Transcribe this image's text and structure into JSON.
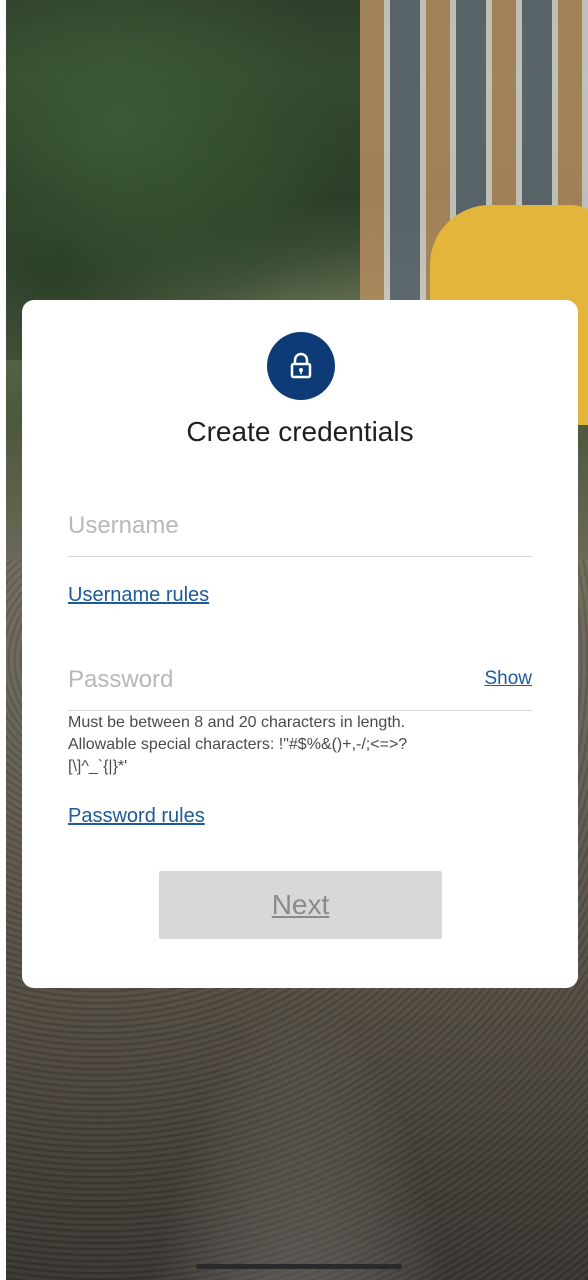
{
  "card": {
    "title": "Create credentials"
  },
  "username": {
    "placeholder": "Username",
    "rules_link": "Username rules"
  },
  "password": {
    "placeholder": "Password",
    "show_label": "Show",
    "hint_line1": "Must be between 8 and 20 characters in length.",
    "hint_line2": "Allowable special characters: !\"#$%&()+,-/;<=>?",
    "hint_line3": "[\\]^_`{|}*'",
    "rules_link": "Password rules"
  },
  "next_button": {
    "label": "Next",
    "state": "disabled"
  },
  "icons": {
    "lock": "lock-icon"
  },
  "colors": {
    "accent": "#0d3b78",
    "link": "#1d5a9a",
    "button_disabled": "#d8d8d8"
  }
}
